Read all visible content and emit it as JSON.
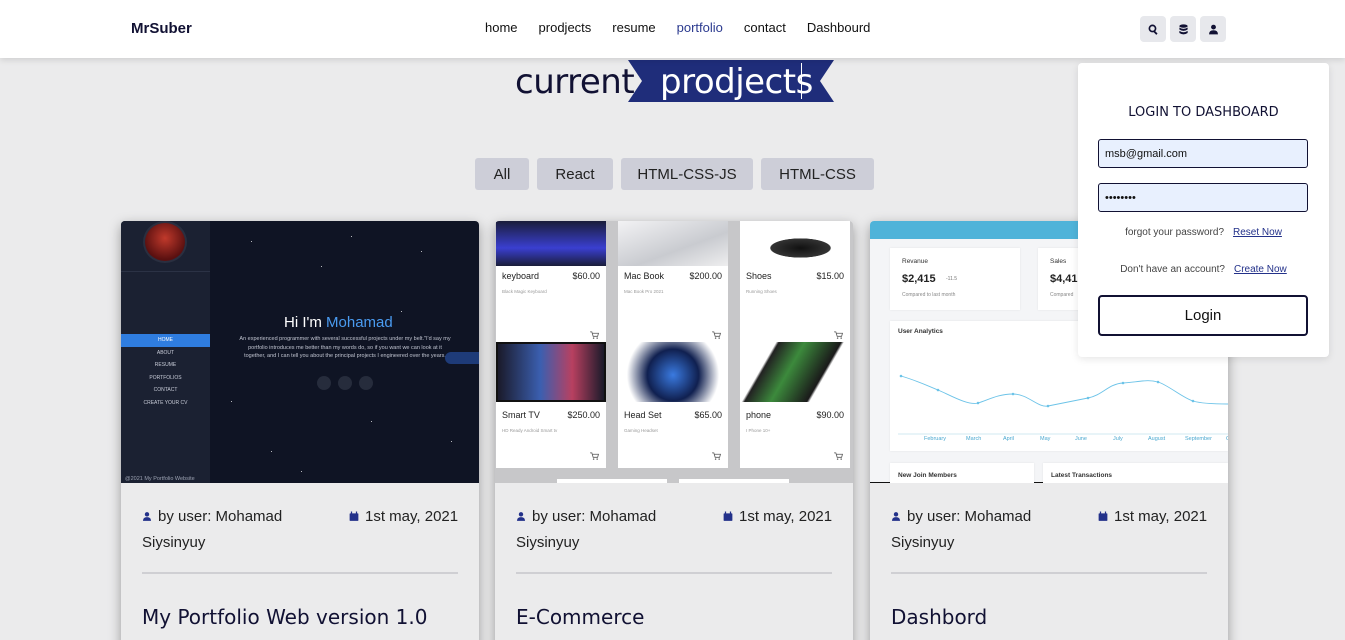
{
  "header": {
    "logo": "MrSuber",
    "nav": [
      "home",
      "prodjects",
      "resume",
      "portfolio",
      "contact",
      "Dashbourd"
    ],
    "active_nav": "portfolio",
    "icons": [
      "search-icon",
      "database-icon",
      "user-icon"
    ]
  },
  "hero": {
    "title_part1": "current",
    "title_part2": "prodjects",
    "ribbon_color": "#1f2d7a"
  },
  "filters": [
    "All",
    "React",
    "HTML-CSS-JS",
    "HTML-CSS"
  ],
  "cards": [
    {
      "user_label": "by user: Mohamad Siysinyuy",
      "date": "1st may, 2021",
      "title": "My Portfolio Web version 1.0",
      "preview": {
        "menu": [
          "HOME",
          "ABOUT",
          "RESUME",
          "PORTFOLIOS",
          "CONTACT",
          "CREATE YOUR CV"
        ],
        "greeting": "Hi I'm",
        "name": "Mohamad",
        "intro": "An experienced programmer with several successful projects under my belt.\"I'd say my portfolio introduces me better than my words do, so if you want we can look at it together, and I can tell you about the principal projects I engineered over the years.",
        "footer": "@2021 My Portfolio Website"
      }
    },
    {
      "user_label": "by user: Mohamad Siysinyuy",
      "date": "1st may, 2021",
      "title": "E-Commerce",
      "preview": {
        "products": [
          {
            "name": "keyboard",
            "price": "$60.00",
            "desc": "Black Magic Keyboard"
          },
          {
            "name": "Mac Book",
            "price": "$200.00",
            "desc": "Mac Book Pro 2021"
          },
          {
            "name": "Shoes",
            "price": "$15.00",
            "desc": "Running Shoes"
          },
          {
            "name": "Smart TV",
            "price": "$250.00",
            "desc": "HD Ready Android Smart tv"
          },
          {
            "name": "Head Set",
            "price": "$65.00",
            "desc": "Gaming Headset"
          },
          {
            "name": "phone",
            "price": "$90.00",
            "desc": "I Phone 10+"
          }
        ]
      }
    },
    {
      "user_label": "by user: Mohamad Siysinyuy",
      "date": "1st may, 2021",
      "title": "Dashbord",
      "preview": {
        "revenue_label": "Revanue",
        "revenue_value": "$2,415",
        "revenue_change": "-11.5",
        "revenue_note": "Compared to last month",
        "sales_label": "Sales",
        "sales_value": "$4,41",
        "sales_note": "Compared",
        "analytics_title": "User Analytics",
        "months": [
          "February",
          "March",
          "April",
          "May",
          "June",
          "July",
          "August",
          "September",
          "Oc"
        ],
        "members_title": "New Join Members",
        "transactions_title": "Latest Transactions"
      }
    }
  ],
  "login": {
    "title": "LOGIN TO DASHBOARD",
    "email_value": "msb@gmail.com",
    "password_value": "••••••••",
    "forgot_text": "forgot your password?",
    "reset_link": "Reset Now",
    "account_text": "Don't have an account?",
    "create_link": "Create Now",
    "button_label": "Login"
  }
}
